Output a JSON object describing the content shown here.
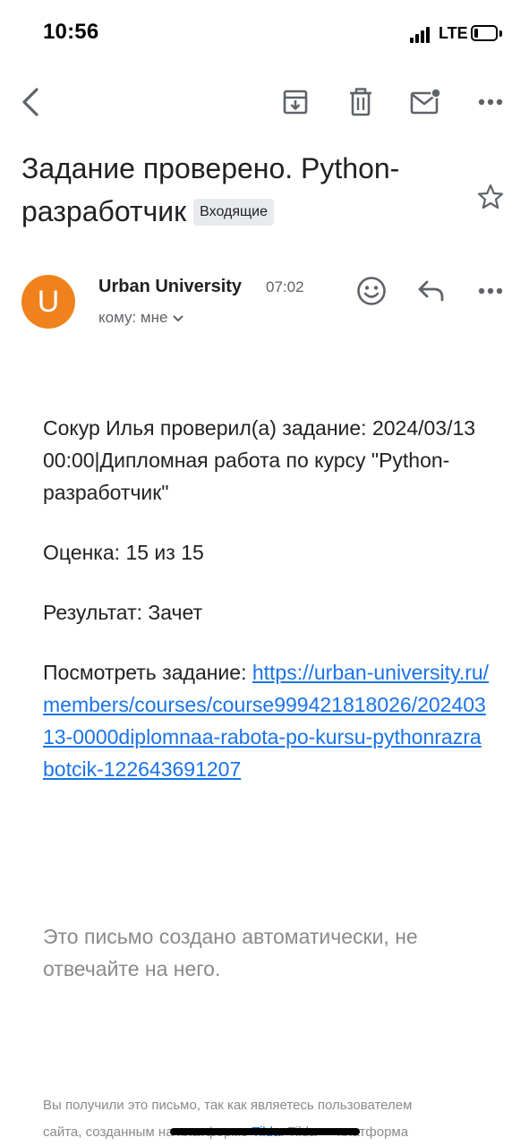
{
  "status_bar": {
    "time": "10:56",
    "network": "LTE",
    "battery_level": 0.2
  },
  "toolbar": {
    "back_icon": "arrow-left-icon",
    "archive_icon": "archive-icon",
    "delete_icon": "trash-icon",
    "mark_unread_icon": "mail-unread-icon",
    "more_icon": "more-horizontal-icon"
  },
  "subject": {
    "text": "Задание проверено. Python-разработчик",
    "label": "Входящие",
    "star_icon": "star-outline-icon"
  },
  "sender": {
    "avatar_letter": "U",
    "avatar_color": "#f0821e",
    "name": "Urban University",
    "time": "07:02",
    "recipient": "кому: мне",
    "emoji_icon": "emoji-icon",
    "reply_icon": "reply-icon",
    "more_icon": "more-horizontal-icon"
  },
  "body": {
    "line1": "Сокур Илья проверил(а) задание: 2024/03/13 00:00|Дипломная работа по курсу \"Python-разработчик\"",
    "grade": "Оценка: 15 из 15",
    "result": "Результат: Зачет",
    "view_label": "Посмотреть задание: ",
    "view_link": "https://urban-university.ru/members/courses/course999421818026/20240313-0000diplomnaa-rabota-po-kursu-pythonrazrabotcik-122643691207",
    "auto_note": "Это письмо создано автоматически, не отвечайте на него."
  },
  "footer": {
    "line1": "Вы получили это письмо, так как являетесь пользователем",
    "line2_start": "сайта, созданным на платформе ",
    "tilda_link": "Tilda",
    "line2_end": ". Tilda — платформа"
  },
  "colors": {
    "link": "#1a73e8",
    "muted_text": "#8a8a8a",
    "icon": "#5f6368",
    "chip_bg": "#e8eaed"
  }
}
